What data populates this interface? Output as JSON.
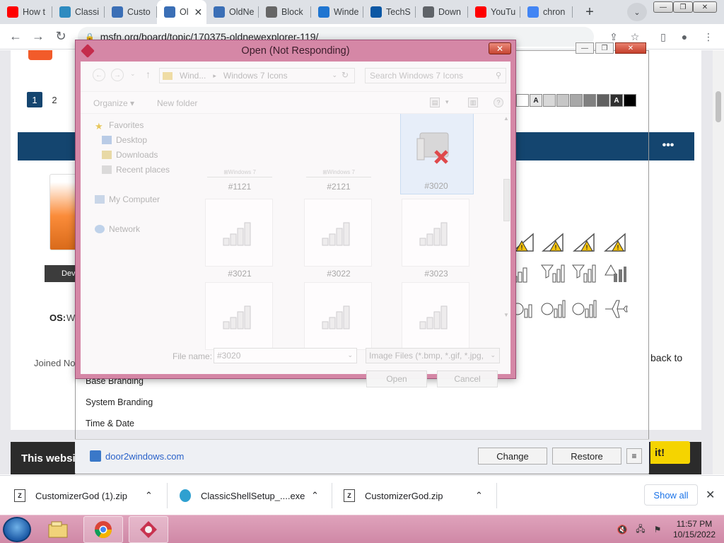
{
  "browser": {
    "tabs": [
      {
        "title": "How t",
        "icon": "youtube-icon",
        "color": "#ff0000"
      },
      {
        "title": "Classi",
        "icon": "classic-shell-icon",
        "color": "#2e8bc0"
      },
      {
        "title": "Custo",
        "icon": "customizer-icon",
        "color": "#3b6fb6"
      },
      {
        "title": "Ol",
        "icon": "msfn-icon",
        "color": "#3b6fb6",
        "active": true
      },
      {
        "title": "OldNe",
        "icon": "msfn-icon",
        "color": "#3b6fb6"
      },
      {
        "title": "Block",
        "icon": "globe-icon",
        "color": "#666666"
      },
      {
        "title": "Winde",
        "icon": "windows-club-icon",
        "color": "#1f75d1"
      },
      {
        "title": "TechS",
        "icon": "techspot-icon",
        "color": "#0b57a4"
      },
      {
        "title": "Down",
        "icon": "download-icon",
        "color": "#5f6368"
      },
      {
        "title": "YouTu",
        "icon": "youtube-icon",
        "color": "#ff0000"
      },
      {
        "title": "chron",
        "icon": "google-icon",
        "color": "#4285f4"
      }
    ],
    "url": "msfn.org/board/topic/170375-oldnewexplorer-119/"
  },
  "page": {
    "pagination": [
      "1",
      "2"
    ],
    "post_more": "•••",
    "user_badge": "Dev",
    "os_label": "OS:",
    "os_value": "W",
    "joined": "Joined No",
    "back_to": "back to",
    "cookie_text": "This websit",
    "cookie_button": "it!"
  },
  "customizer": {
    "sidebar": [
      "Base Branding",
      "System Branding",
      "Time & Date"
    ],
    "link": "door2windows.com",
    "change": "Change",
    "restore": "Restore",
    "menu": "≡"
  },
  "dialog": {
    "title": "Open (Not Responding)",
    "breadcrumb": [
      "Wind...",
      "Windows 7 Icons"
    ],
    "search_placeholder": "Search Windows 7 Icons",
    "organize": "Organize",
    "new_folder": "New folder",
    "nav": {
      "favorites": "Favorites",
      "desktop": "Desktop",
      "downloads": "Downloads",
      "recent": "Recent places",
      "computer": "My Computer",
      "network": "Network"
    },
    "files": [
      {
        "label": "#1121",
        "kind": "banner"
      },
      {
        "label": "#2121",
        "kind": "banner"
      },
      {
        "label": "#3020",
        "kind": "disconnected",
        "selected": true
      },
      {
        "label": "#3021",
        "kind": "signal"
      },
      {
        "label": "#3022",
        "kind": "signal"
      },
      {
        "label": "#3023",
        "kind": "signal"
      },
      {
        "label": "",
        "kind": "signal"
      },
      {
        "label": "",
        "kind": "signal"
      },
      {
        "label": "",
        "kind": "signal"
      }
    ],
    "file_name_label": "File name:",
    "file_name_value": "#3020",
    "file_type": "Image Files (*.bmp, *.gif, *.jpg,",
    "open": "Open",
    "cancel": "Cancel"
  },
  "downloads": [
    {
      "name": "CustomizerGod (1).zip",
      "icon": "zip-icon"
    },
    {
      "name": "ClassicShellSetup_....exe",
      "icon": "classic-shell-icon"
    },
    {
      "name": "CustomizerGod.zip",
      "icon": "zip-icon"
    }
  ],
  "show_all": "Show all",
  "taskbar": {
    "time": "11:57 PM",
    "date": "10/15/2022"
  }
}
